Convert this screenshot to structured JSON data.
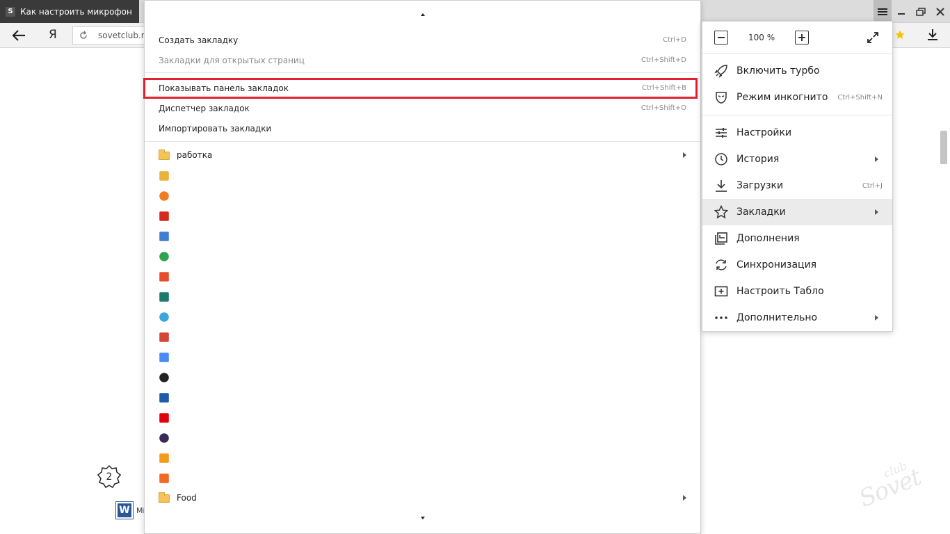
{
  "tab": {
    "favicon_letter": "S",
    "title": "Как настроить микрофон"
  },
  "addressbar": {
    "logo": "Я",
    "url": "sovetclub.r"
  },
  "bookmarks_menu": {
    "actions": [
      {
        "label": "Создать закладку",
        "shortcut": "Ctrl+D",
        "disabled": false
      },
      {
        "label": "Закладки для открытых страниц",
        "shortcut": "Ctrl+Shift+D",
        "disabled": true
      },
      {
        "label": "Показывать панель закладок",
        "shortcut": "Ctrl+Shift+B",
        "highlighted": true
      },
      {
        "label": "Диспетчер закладок",
        "shortcut": "Ctrl+Shift+O"
      },
      {
        "label": "Импортировать закладки",
        "shortcut": ""
      }
    ],
    "folder_top": "работка",
    "folder_bottom": "Food",
    "favicon_colors": [
      "#e9b23a",
      "#f07c1e",
      "#d52b1e",
      "#3d7fd1",
      "#2ea44f",
      "#e64c2e",
      "#1d7a6a",
      "#3da5dc",
      "#d44638",
      "#4a8af4",
      "#222222",
      "#1e5aa8",
      "#e0000f",
      "#3a2a5a",
      "#f29b1d",
      "#f16a22"
    ]
  },
  "main_menu": {
    "zoom": {
      "value": "100 %"
    },
    "items": [
      {
        "label": "Включить турбо",
        "icon": "rocket-icon"
      },
      {
        "label": "Режим инкогнито",
        "icon": "incognito-mask-icon",
        "shortcut": "Ctrl+Shift+N"
      },
      {
        "label": "Настройки",
        "icon": "sliders-icon"
      },
      {
        "label": "История",
        "icon": "clock-icon",
        "submenu": true
      },
      {
        "label": "Загрузки",
        "icon": "download-icon",
        "shortcut": "Ctrl+J"
      },
      {
        "label": "Закладки",
        "icon": "star-icon",
        "submenu": true,
        "active": true
      },
      {
        "label": "Дополнения",
        "icon": "extensions-icon"
      },
      {
        "label": "Синхронизация",
        "icon": "sync-icon"
      },
      {
        "label": "Настроить Табло",
        "icon": "tableau-plus-icon"
      },
      {
        "label": "Дополнительно",
        "icon": "more-dots-icon",
        "submenu": true
      }
    ]
  },
  "page": {
    "step_number": "2",
    "word_label": "Mi",
    "watermark": "Sovet",
    "watermark_sub": "club"
  },
  "colors": {
    "highlight": "#e3202e",
    "active_row": "#ebebeb",
    "star": "#f5c400"
  }
}
